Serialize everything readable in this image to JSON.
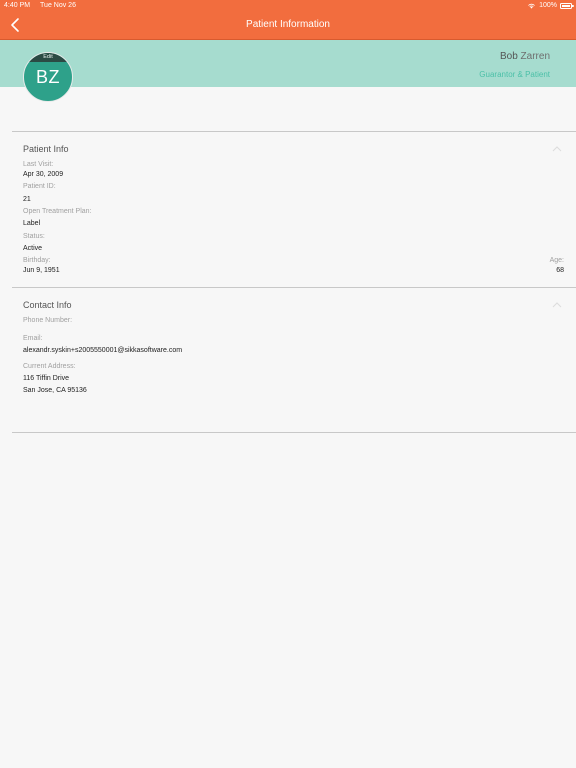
{
  "status_bar": {
    "time": "4:40 PM",
    "date": "Tue Nov 26",
    "battery": "100%"
  },
  "nav": {
    "title": "Patient Information"
  },
  "header": {
    "avatar_edit": "Edit",
    "avatar_initials": "BZ",
    "first_name": "Bob",
    "last_name": "Zarren",
    "role": "Guarantor & Patient"
  },
  "patient_info": {
    "title": "Patient Info",
    "last_visit_label": "Last Visit:",
    "last_visit_value": "Apr 30, 2009",
    "patient_id_label": "Patient ID:",
    "patient_id_value": "21",
    "treatment_plan_label": "Open Treatment Plan:",
    "treatment_plan_value": "Label",
    "status_label": "Status:",
    "status_value": "Active",
    "birthday_label": "Birthday:",
    "birthday_value": "Jun 9, 1951",
    "age_label": "Age:",
    "age_value": "68"
  },
  "contact_info": {
    "title": "Contact Info",
    "phone_label": "Phone Number:",
    "email_label": "Email:",
    "email_value": "alexandr.syskin+s2005550001@sikkasoftware.com",
    "address_label": "Current Address:",
    "address_line1": "116 Tiffin Drive",
    "address_line2": "San Jose, CA 95136"
  }
}
